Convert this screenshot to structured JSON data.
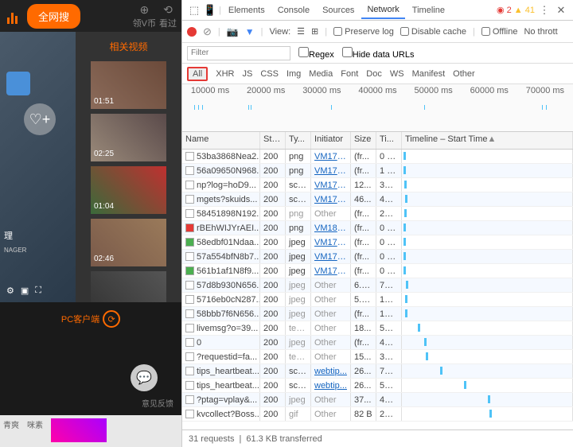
{
  "left": {
    "search": "全网搜",
    "top1": "领V币",
    "top2": "看过",
    "related": "相关视频",
    "durs": [
      "01:51",
      "02:25",
      "01:04",
      "02:46"
    ],
    "mgr": "理",
    "mgr2": "NAGER",
    "promo": "PC客户端",
    "fb": "意见反馈",
    "foot1": "青爽",
    "foot2": "咪素"
  },
  "tabs": [
    "Elements",
    "Console",
    "Sources",
    "Network",
    "Timeline"
  ],
  "warn": {
    "err": "2",
    "wrn": "41"
  },
  "toolbar": {
    "view": "View:",
    "preserve": "Preserve log",
    "disable": "Disable cache",
    "offline": "Offline",
    "throttle": "No thrott"
  },
  "filter": {
    "placeholder": "Filter",
    "regex": "Regex",
    "hide": "Hide data URLs"
  },
  "types": [
    "All",
    "XHR",
    "JS",
    "CSS",
    "Img",
    "Media",
    "Font",
    "Doc",
    "WS",
    "Manifest",
    "Other"
  ],
  "tl": [
    "10000 ms",
    "20000 ms",
    "30000 ms",
    "40000 ms",
    "50000 ms",
    "60000 ms",
    "70000 ms"
  ],
  "cols": {
    "name": "Name",
    "sta": "Sta...",
    "ty": "Ty...",
    "init": "Initiator",
    "size": "Size",
    "ti": "Ti...",
    "tl": "Timeline – Start Time"
  },
  "rows": [
    {
      "n": "53ba3868Nea2...",
      "s": "200",
      "t": "png",
      "i": "VM179...",
      "ig": 0,
      "sz": "(fr...",
      "ti": "0 ms",
      "b": 2
    },
    {
      "n": "56a09650N968...",
      "s": "200",
      "t": "png",
      "i": "VM179...",
      "ig": 0,
      "sz": "(fr...",
      "ti": "1 ms",
      "b": 2
    },
    {
      "n": "np?log=hoD9...",
      "s": "200",
      "t": "scr...",
      "i": "VM179...",
      "ig": 0,
      "sz": "12...",
      "ti": "39 ...",
      "b": 3
    },
    {
      "n": "mgets?skuids...",
      "s": "200",
      "t": "scr...",
      "i": "VM179...",
      "ig": 0,
      "sz": "46...",
      "ti": "44 ...",
      "b": 4
    },
    {
      "n": "58451898N192...",
      "s": "200",
      "t": "png",
      "i": "Other",
      "ig": 1,
      "sz": "(fr...",
      "ti": "21 ...",
      "b": 3
    },
    {
      "n": "rBEhWIJYrAEI...",
      "s": "200",
      "t": "png",
      "i": "VM181...",
      "ig": 0,
      "sz": "(fr...",
      "ti": "0 ms",
      "b": 2,
      "fic": "red"
    },
    {
      "n": "58edbf01Ndaa...",
      "s": "200",
      "t": "jpeg",
      "i": "VM179...",
      "ig": 0,
      "sz": "(fr...",
      "ti": "0 ms",
      "b": 2,
      "fic": "img"
    },
    {
      "n": "57a554bfN8b7...",
      "s": "200",
      "t": "jpeg",
      "i": "VM179...",
      "ig": 0,
      "sz": "(fr...",
      "ti": "0 ms",
      "b": 2
    },
    {
      "n": "561b1af1N8f9...",
      "s": "200",
      "t": "jpeg",
      "i": "VM179...",
      "ig": 0,
      "sz": "(fr...",
      "ti": "0 ms",
      "b": 2,
      "fic": "img"
    },
    {
      "n": "57d8b930N656...",
      "s": "200",
      "t": "jpeg",
      "i": "Other",
      "ig": 1,
      "sz": "6.0...",
      "ti": "77 ...",
      "b": 5
    },
    {
      "n": "5716eb0cN287...",
      "s": "200",
      "t": "jpeg",
      "i": "Other",
      "ig": 1,
      "sz": "5.9...",
      "ti": "14 ...",
      "b": 4
    },
    {
      "n": "58bbb7f6N656...",
      "s": "200",
      "t": "jpeg",
      "i": "Other",
      "ig": 1,
      "sz": "(fr...",
      "ti": "14 ...",
      "b": 4
    },
    {
      "n": "livemsg?o=39...",
      "s": "200",
      "t": "tex...",
      "i": "Other",
      "ig": 1,
      "sz": "18...",
      "ti": "50 ...",
      "b": 20
    },
    {
      "n": "0",
      "s": "200",
      "t": "jpeg",
      "i": "Other",
      "ig": 1,
      "sz": "(fr...",
      "ti": "45 ...",
      "b": 28
    },
    {
      "n": "?requestid=fa...",
      "s": "200",
      "t": "tex...",
      "i": "Other",
      "ig": 1,
      "sz": "15...",
      "ti": "39 ...",
      "b": 30
    },
    {
      "n": "tips_heartbeat...",
      "s": "200",
      "t": "scr...",
      "i": "webtip...",
      "ig": 0,
      "sz": "26...",
      "ti": "71 ...",
      "b": 48
    },
    {
      "n": "tips_heartbeat...",
      "s": "200",
      "t": "scr...",
      "i": "webtip...",
      "ig": 0,
      "sz": "26...",
      "ti": "57 ...",
      "b": 78
    },
    {
      "n": "?ptag=vplay&...",
      "s": "200",
      "t": "jpeg",
      "i": "Other",
      "ig": 1,
      "sz": "37...",
      "ti": "40 ...",
      "b": 108
    },
    {
      "n": "kvcollect?Boss...",
      "s": "200",
      "t": "gif",
      "i": "Other",
      "ig": 1,
      "sz": "82 B",
      "ti": "26 ...",
      "b": 110
    }
  ],
  "status": {
    "req": "31 requests",
    "kb": "61.3 KB transferred"
  }
}
